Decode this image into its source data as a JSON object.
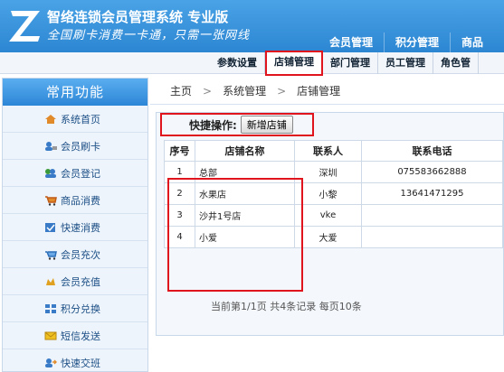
{
  "header": {
    "app_title": "智络连锁会员管理系统 专业版",
    "slogan": "全国刷卡消费一卡通，只需一张网线",
    "nav": [
      "会员管理",
      "积分管理",
      "商品"
    ]
  },
  "subnav": {
    "items": [
      "参数设置",
      "店铺管理",
      "部门管理",
      "员工管理",
      "角色管"
    ],
    "active": "店铺管理"
  },
  "sidebar": {
    "title": "常用功能",
    "items": [
      {
        "label": "系统首页",
        "icon": "home-icon"
      },
      {
        "label": "会员刷卡",
        "icon": "member-card-icon"
      },
      {
        "label": "会员登记",
        "icon": "member-register-icon"
      },
      {
        "label": "商品消费",
        "icon": "cart-icon"
      },
      {
        "label": "快速消费",
        "icon": "quick-pay-icon"
      },
      {
        "label": "会员充次",
        "icon": "recharge-count-icon"
      },
      {
        "label": "会员充值",
        "icon": "recharge-icon"
      },
      {
        "label": "积分兑换",
        "icon": "points-icon"
      },
      {
        "label": "短信发送",
        "icon": "sms-icon"
      },
      {
        "label": "快速交班",
        "icon": "handover-icon"
      }
    ]
  },
  "breadcrumb": [
    "主页",
    "系统管理",
    "店铺管理"
  ],
  "quick_ops": {
    "label": "快捷操作:",
    "add_button": "新增店铺"
  },
  "table": {
    "headers": [
      "序号",
      "店铺名称",
      "联系人",
      "联系电话"
    ],
    "rows": [
      [
        "1",
        "总部",
        "深圳",
        "075583662888"
      ],
      [
        "2",
        "水果店",
        "小黎",
        "13641471295"
      ],
      [
        "3",
        "沙井1号店",
        "vke",
        ""
      ],
      [
        "4",
        "小爱",
        "大爱",
        ""
      ]
    ]
  },
  "pager": "当前第1/1页 共4条记录 每页10条",
  "colors": {
    "header_blue": "#2c86d2",
    "highlight_red": "#e0141d",
    "link_blue": "#1c4f86"
  }
}
